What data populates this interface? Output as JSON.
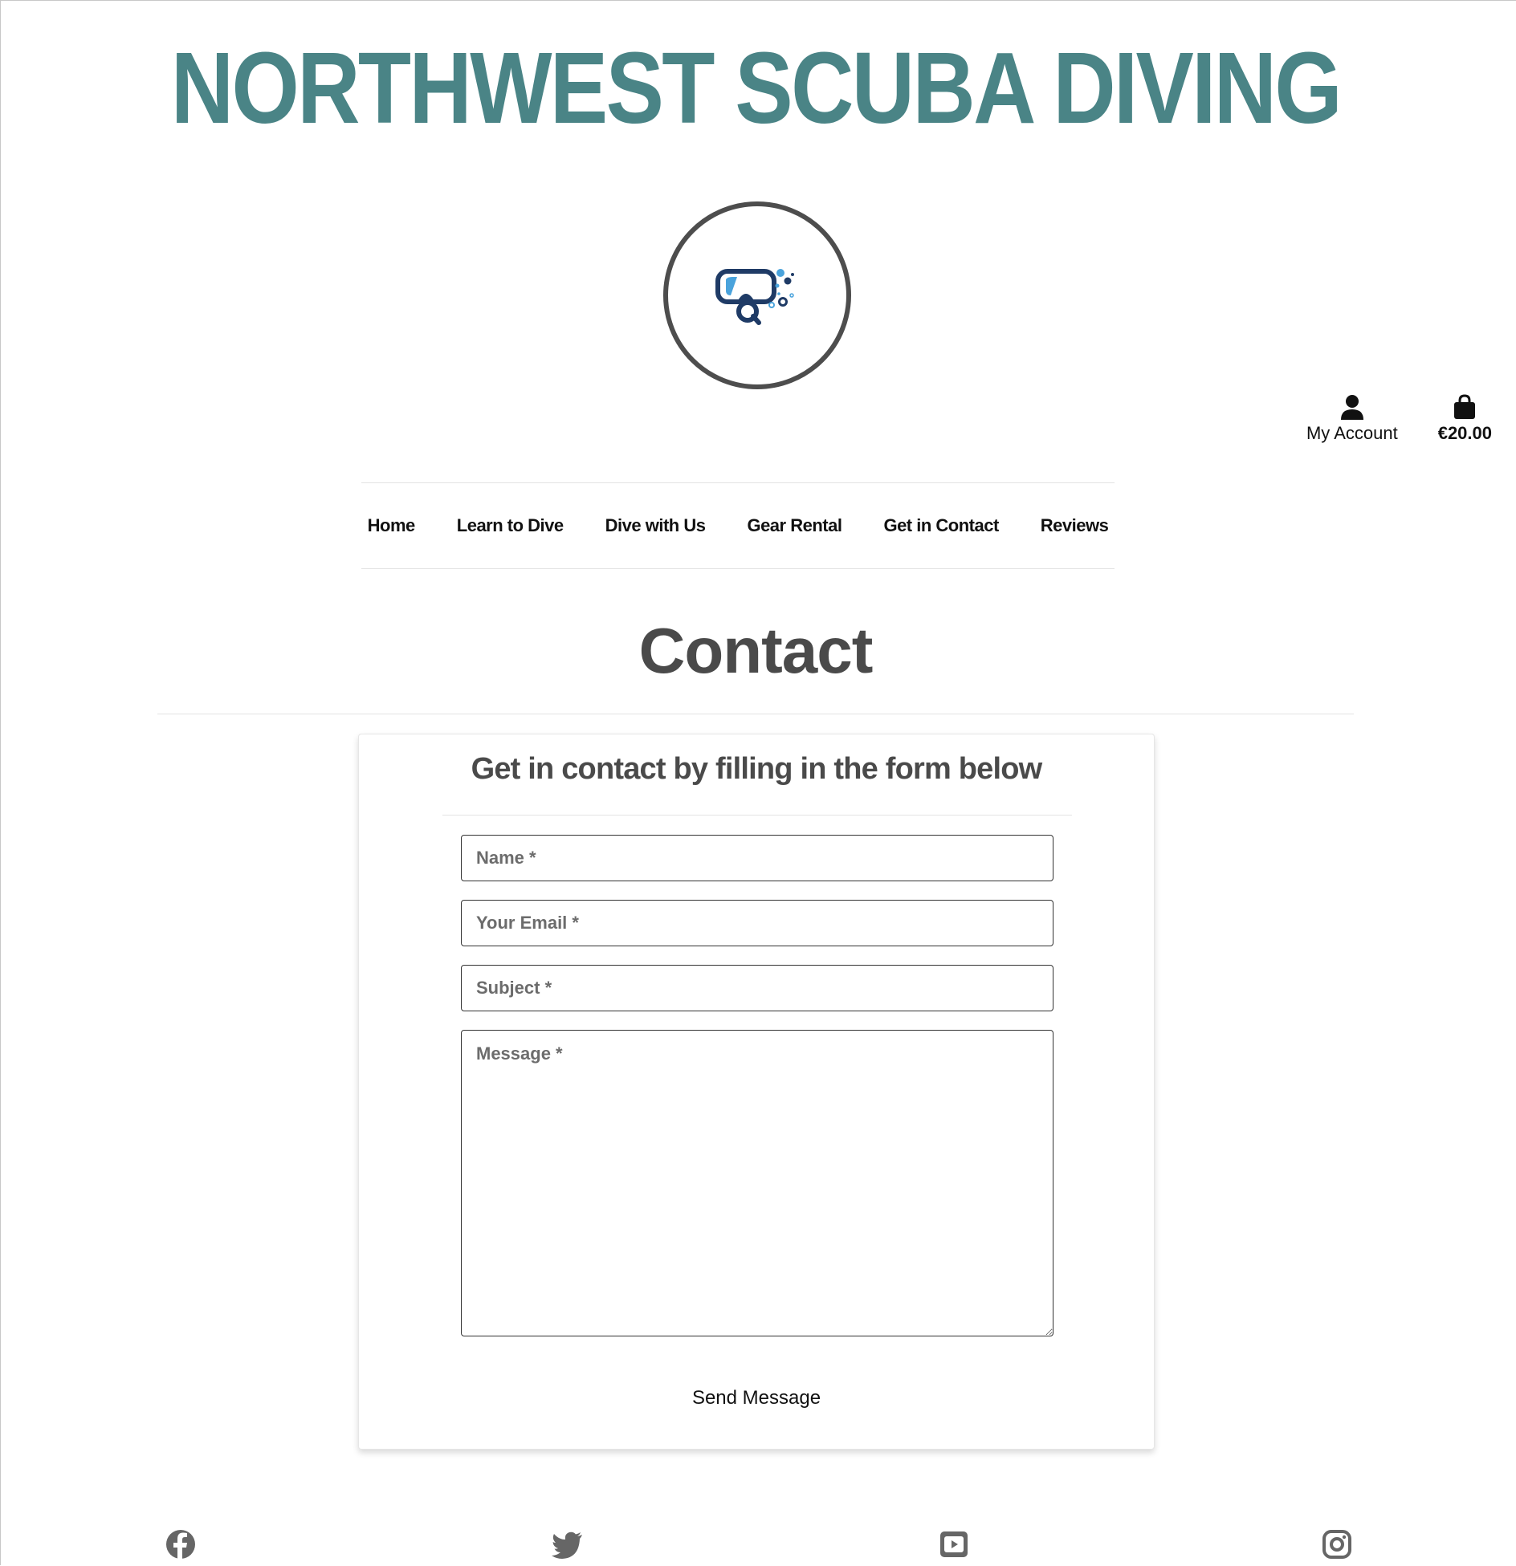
{
  "header": {
    "site_title": "NORTHWEST SCUBA DIVING",
    "account_label": "My Account",
    "bag_total": "€20.00",
    "icons": {
      "account": "user-icon",
      "bag": "shopping-bag-icon"
    }
  },
  "nav": {
    "items": [
      {
        "label": "Home"
      },
      {
        "label": "Learn to Dive"
      },
      {
        "label": "Dive with Us"
      },
      {
        "label": "Gear Rental"
      },
      {
        "label": "Get in Contact"
      },
      {
        "label": "Reviews"
      }
    ]
  },
  "main": {
    "page_title": "Contact",
    "form": {
      "heading": "Get in contact by filling in the form below",
      "name_placeholder": "Name *",
      "email_placeholder": "Your Email *",
      "subject_placeholder": "Subject *",
      "message_placeholder": "Message *",
      "submit_label": "Send Message"
    }
  },
  "footer": {
    "social": [
      "facebook-icon",
      "twitter-icon",
      "youtube-icon",
      "instagram-icon"
    ]
  },
  "colors": {
    "brand_teal": "#4a8486",
    "heading_gray": "#4a4a4a",
    "logo_dark_blue": "#1f3b66",
    "logo_light_blue": "#4aa3dc"
  }
}
